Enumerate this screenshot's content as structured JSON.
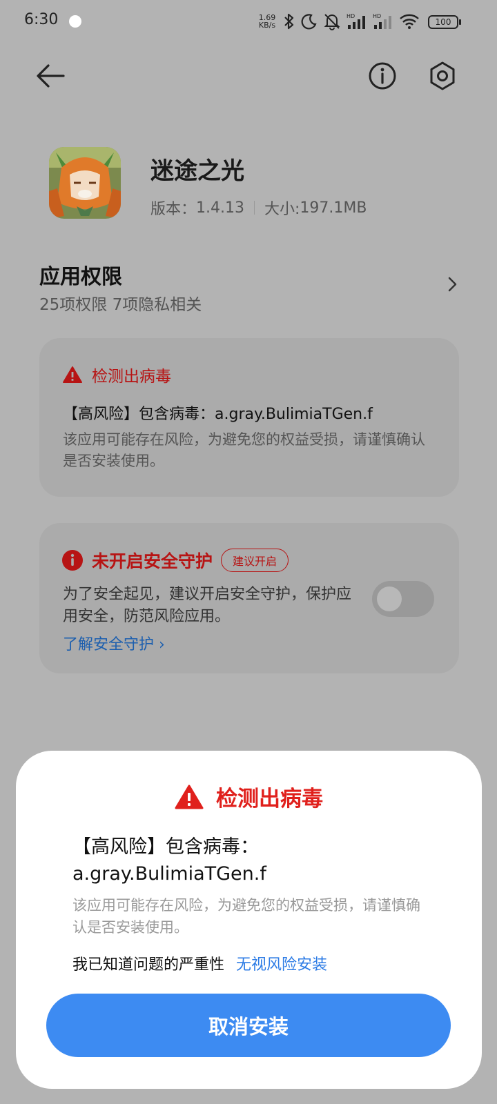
{
  "status_bar": {
    "time": "6:30",
    "net_speed_value": "1.69",
    "net_speed_unit": "KB/s",
    "battery": "100",
    "hd_label": "HD"
  },
  "toolbar": {
    "back_icon": "arrow-left-icon",
    "info_icon": "info-icon",
    "settings_icon": "settings-hexagon-icon"
  },
  "app": {
    "name": "迷途之光",
    "version_label": "版本：",
    "version": "1.4.13",
    "size_label": "大小:",
    "size": "197.1MB"
  },
  "permissions": {
    "title": "应用权限",
    "summary": "25项权限 7项隐私相关"
  },
  "virus_card": {
    "title": "检测出病毒",
    "risk_line": "【高风险】包含病毒：a.gray.BulimiaTGen.f",
    "description": "该应用可能存在风险，为避免您的权益受损，请谨慎确认是否安装使用。"
  },
  "protection_card": {
    "title": "未开启安全守护",
    "chip": "建议开启",
    "description": "为了安全起见，建议开启安全守护，保护应用安全，防范风险应用。",
    "link": "了解安全守护",
    "toggle_on": false
  },
  "dialog": {
    "title": "检测出病毒",
    "risk_line1": "【高风险】包含病毒：",
    "risk_line2": "a.gray.BulimiaTGen.f",
    "description": "该应用可能存在风险，为避免您的权益受损，请谨慎确认是否安装使用。",
    "ack_text": "我已知道问题的严重性",
    "ignore_link": "无视风险安装",
    "cancel_button": "取消安装"
  },
  "colors": {
    "danger": "#e0201c",
    "danger_dim": "#b71414",
    "primary_button": "#3d8bf2",
    "link": "#2c7be5",
    "scrim_bg": "#b3b3b3"
  }
}
